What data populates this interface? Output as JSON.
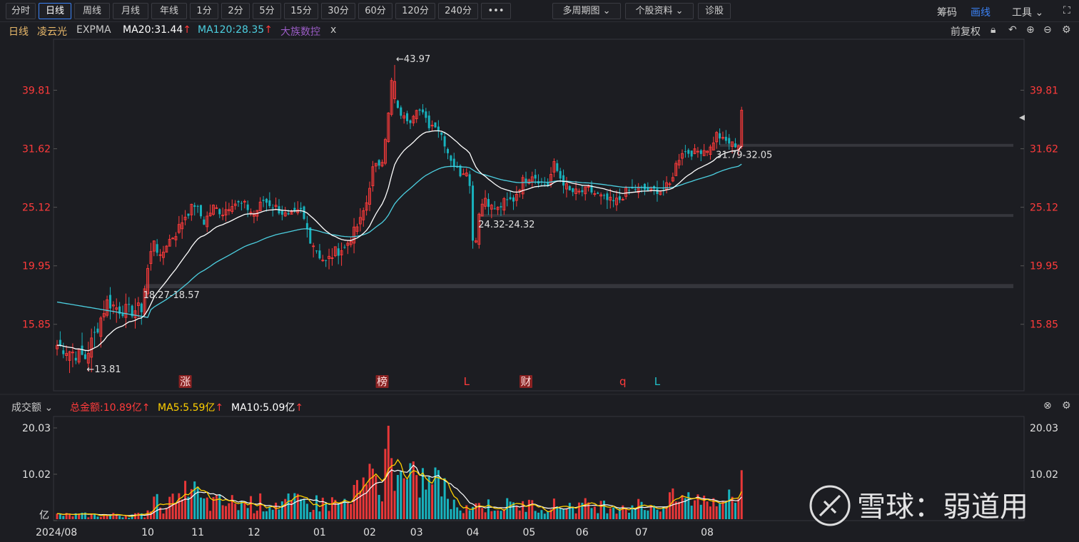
{
  "toolbar": {
    "tabs": [
      "分时",
      "日线",
      "周线",
      "月线",
      "年线",
      "1分",
      "2分",
      "5分",
      "15分",
      "30分",
      "60分",
      "120分",
      "240分",
      "•••"
    ],
    "active_tab": "日线",
    "dropdowns": [
      "多周期图 ⌄",
      "个股资料 ⌄",
      "诊股"
    ],
    "right_links": {
      "chips": "筹码",
      "draw": "画线",
      "tools": "工具 ⌄"
    }
  },
  "info": {
    "period": "日线",
    "name": "凌云光",
    "indicator": "EXPMA",
    "ma20": "MA20:31.44",
    "ma120": "MA120:28.35",
    "peer": "大族数控",
    "peer_close": "x",
    "adjust": "前复权"
  },
  "vol_info": {
    "label": "成交额 ⌄",
    "total": "总金额:10.89亿",
    "ma5": "MA5:5.59亿",
    "ma10": "MA10:5.09亿"
  },
  "watermark": "雪球：弱道用",
  "colors": {
    "up": "#ff3b3b",
    "down": "#18b2bd",
    "ma20": "#ffffff",
    "ma120": "#4ccfe0",
    "ma5": "#ffd000",
    "bg": "#1c1d22"
  },
  "chart_data": {
    "type": "candlestick",
    "y_ticks": [
      "39.81",
      "31.62",
      "25.12",
      "19.95",
      "15.85"
    ],
    "y_tick_values": [
      39.81,
      31.62,
      25.12,
      19.95,
      15.85
    ],
    "y_scale": "log",
    "ylim": [
      12.2,
      46.0
    ],
    "annotations": {
      "high": "←43.97",
      "low": "←13.81",
      "zone1": "18.27-18.57",
      "zone2": "24.32-24.32",
      "zone3": "31.79-32.05"
    },
    "zones": [
      [
        18.27,
        18.57
      ],
      [
        24.32,
        24.32
      ],
      [
        31.79,
        32.05
      ]
    ],
    "event_markers": [
      {
        "label": "涨",
        "bar": 41,
        "color": "#ff4040",
        "boxed": true
      },
      {
        "label": "榜",
        "bar": 104,
        "color": "#ff4040",
        "boxed": true
      },
      {
        "label": "L",
        "bar": 131,
        "color": "#ff3b3b",
        "boxed": false
      },
      {
        "label": "财",
        "bar": 150,
        "color": "#ff4040",
        "boxed": true
      },
      {
        "label": "q",
        "bar": 181,
        "color": "#ff3b3b",
        "boxed": false
      },
      {
        "label": "L",
        "bar": 192,
        "color": "#20c0c8",
        "boxed": false
      }
    ],
    "x_labels": [
      {
        "label": "2024/08",
        "bar": 0
      },
      {
        "label": "10",
        "bar": 29
      },
      {
        "label": "11",
        "bar": 45
      },
      {
        "label": "12",
        "bar": 63
      },
      {
        "label": "01",
        "bar": 84
      },
      {
        "label": "02",
        "bar": 100
      },
      {
        "label": "03",
        "bar": 115
      },
      {
        "label": "04",
        "bar": 133
      },
      {
        "label": "05",
        "bar": 151
      },
      {
        "label": "06",
        "bar": 168
      },
      {
        "label": "07",
        "bar": 187
      },
      {
        "label": "08",
        "bar": 208
      }
    ],
    "vol_ticks": [
      "20.03",
      "10.02",
      "亿"
    ],
    "vol_tick_values": [
      20.03,
      10.02,
      0
    ],
    "vol_ylim": [
      0,
      22.5
    ],
    "anchors": [
      [
        0,
        14.6
      ],
      [
        5,
        14.2
      ],
      [
        9,
        13.9
      ],
      [
        12,
        15.2
      ],
      [
        16,
        17.3
      ],
      [
        20,
        16.8
      ],
      [
        24,
        16.7
      ],
      [
        27,
        16.9
      ],
      [
        29,
        19.7
      ],
      [
        31,
        22.2
      ],
      [
        33,
        20.4
      ],
      [
        35,
        21.8
      ],
      [
        38,
        22.7
      ],
      [
        41,
        24.3
      ],
      [
        44,
        25.4
      ],
      [
        47,
        23.7
      ],
      [
        50,
        25.1
      ],
      [
        53,
        24.6
      ],
      [
        56,
        25.6
      ],
      [
        60,
        25.3
      ],
      [
        63,
        24.4
      ],
      [
        66,
        25.8
      ],
      [
        70,
        25.1
      ],
      [
        74,
        24.1
      ],
      [
        78,
        24.7
      ],
      [
        81,
        22.2
      ],
      [
        84,
        20.8
      ],
      [
        86,
        20.2
      ],
      [
        89,
        21.1
      ],
      [
        92,
        21.4
      ],
      [
        95,
        22.8
      ],
      [
        97,
        23.8
      ],
      [
        99,
        25.6
      ],
      [
        101,
        29.2
      ],
      [
        103,
        29.8
      ],
      [
        104,
        30.4
      ],
      [
        105,
        33.1
      ],
      [
        106,
        36.2
      ],
      [
        107,
        41.2
      ],
      [
        108,
        38.4
      ],
      [
        109,
        36.8
      ],
      [
        111,
        35.7
      ],
      [
        113,
        35.4
      ],
      [
        115,
        37.2
      ],
      [
        117,
        36.2
      ],
      [
        119,
        34.6
      ],
      [
        121,
        34.8
      ],
      [
        123,
        33.4
      ],
      [
        125,
        31.2
      ],
      [
        127,
        29.6
      ],
      [
        129,
        28.7
      ],
      [
        131,
        29.2
      ],
      [
        132,
        27.2
      ],
      [
        133,
        22.4
      ],
      [
        134,
        22.1
      ],
      [
        135,
        24.8
      ],
      [
        137,
        26.1
      ],
      [
        139,
        25.1
      ],
      [
        141,
        24.9
      ],
      [
        143,
        25.6
      ],
      [
        146,
        25.9
      ],
      [
        149,
        27.9
      ],
      [
        152,
        28.6
      ],
      [
        155,
        27.7
      ],
      [
        157,
        27.4
      ],
      [
        159,
        29.7
      ],
      [
        161,
        28.2
      ],
      [
        164,
        26.7
      ],
      [
        167,
        26.6
      ],
      [
        170,
        26.9
      ],
      [
        173,
        26.3
      ],
      [
        176,
        25.8
      ],
      [
        178,
        25.6
      ],
      [
        180,
        25.9
      ],
      [
        182,
        26.7
      ],
      [
        185,
        27.0
      ],
      [
        188,
        26.9
      ],
      [
        190,
        26.8
      ],
      [
        193,
        26.9
      ],
      [
        196,
        27.4
      ],
      [
        198,
        29.7
      ],
      [
        200,
        31.3
      ],
      [
        203,
        31.1
      ],
      [
        206,
        31.4
      ],
      [
        209,
        31.7
      ],
      [
        211,
        33.5
      ],
      [
        213,
        32.7
      ],
      [
        216,
        32.2
      ],
      [
        218,
        32.0
      ]
    ],
    "last_bar": {
      "open": 31.9,
      "close": 36.8,
      "high": 37.3,
      "low": 31.6
    }
  }
}
